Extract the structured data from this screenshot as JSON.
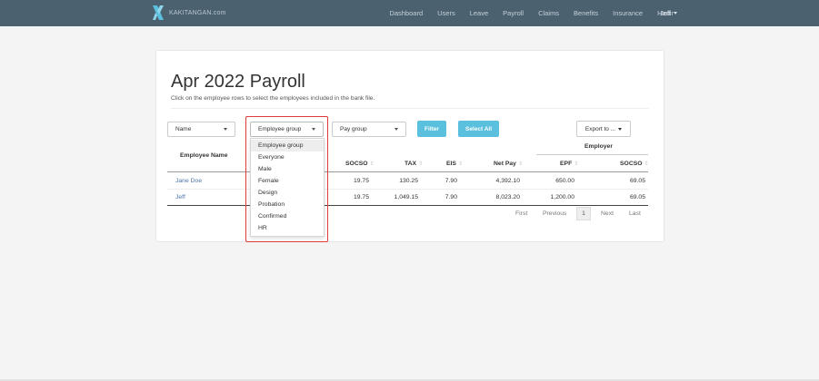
{
  "brand": {
    "name": "KAKITANGAN.com",
    "accent": "#5bc0de",
    "navbar_bg": "#4b6170"
  },
  "nav": {
    "items": [
      "Dashboard",
      "Users",
      "Leave",
      "Payroll",
      "Claims",
      "Benefits",
      "Insurance",
      "Hadir"
    ],
    "user": "Jeff"
  },
  "page": {
    "title": "Apr 2022 Payroll",
    "subtitle": "Click on the employee rows to select the employees included in the bank file."
  },
  "filters": {
    "name": "Name",
    "employee_group": "Employee group",
    "pay_group": "Pay group",
    "filter_label": "Filter",
    "select_all_label": "Select All",
    "export_label": "Export to ..."
  },
  "dropdown": {
    "options": [
      "Employee group",
      "Everyone",
      "Male",
      "Female",
      "Design",
      "Probation",
      "Confirmed",
      "HR"
    ],
    "selected": "Employee group"
  },
  "table": {
    "group_header": "Employer",
    "employee_name_header": "Employee Name",
    "columns": [
      "SOCSO",
      "TAX",
      "EIS",
      "Net Pay",
      "EPF",
      "SOCSO"
    ],
    "rows": [
      {
        "name": "Jane Doe",
        "values": [
          "19.75",
          "130.25",
          "7.90",
          "4,392.10",
          "650.00",
          "69.05"
        ]
      },
      {
        "name": "Jeff",
        "values": [
          "19.75",
          "1,049.15",
          "7.90",
          "8,023.20",
          "1,200.00",
          "69.05"
        ]
      }
    ]
  },
  "pagination": {
    "first": "First",
    "previous": "Previous",
    "current": "1",
    "next": "Next",
    "last": "Last"
  },
  "icons": {
    "logo": "x-logo-icon",
    "caret": "caret-down-icon",
    "sort": "sort-icon"
  }
}
